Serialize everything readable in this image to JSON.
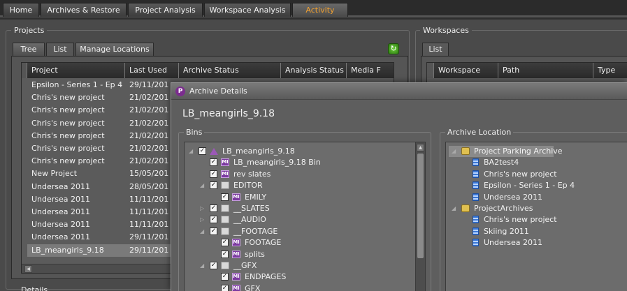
{
  "tabs": [
    {
      "label": "Home"
    },
    {
      "label": "Archives & Restore"
    },
    {
      "label": "Project Analysis"
    },
    {
      "label": "Workspace Analysis"
    },
    {
      "label": "Activity"
    }
  ],
  "active_tab": "Activity",
  "accent_color": "#f0a030",
  "projects": {
    "title": "Projects",
    "subtabs": [
      {
        "label": "Tree"
      },
      {
        "label": "List"
      },
      {
        "label": "Manage Locations"
      }
    ],
    "active_subtab": "List",
    "refresh_icon": "refresh-icon",
    "columns": [
      "Project",
      "Last Used",
      "Archive Status",
      "Analysis Status",
      "Media F"
    ],
    "rows": [
      {
        "project": "Epsilon - Series 1 - Ep 4",
        "last_used": "29/11/201"
      },
      {
        "project": "Chris's new project",
        "last_used": "21/02/201"
      },
      {
        "project": "Chris's new project",
        "last_used": "21/02/201"
      },
      {
        "project": "Chris's new project",
        "last_used": "21/02/201"
      },
      {
        "project": "Chris's new project",
        "last_used": "21/02/201"
      },
      {
        "project": "Chris's new project",
        "last_used": "21/02/201"
      },
      {
        "project": "Chris's new project",
        "last_used": "21/02/201"
      },
      {
        "project": "New Project",
        "last_used": "15/05/201"
      },
      {
        "project": "Undersea 2011",
        "last_used": "28/05/201"
      },
      {
        "project": "Undersea 2011",
        "last_used": "11/11/201"
      },
      {
        "project": "Undersea 2011",
        "last_used": "11/11/201"
      },
      {
        "project": "Undersea 2011",
        "last_used": "11/11/201"
      },
      {
        "project": "Undersea 2011",
        "last_used": "29/11/201"
      },
      {
        "project": "LB_meangirls_9.18",
        "last_used": "29/11/201"
      }
    ],
    "selected_row": "LB_meangirls_9.18",
    "details_label": "Details"
  },
  "workspaces": {
    "title": "Workspaces",
    "subtabs": [
      {
        "label": "List"
      }
    ],
    "columns": [
      "Workspace",
      "Path",
      "Type"
    ]
  },
  "archive_details": {
    "window_title": "Archive Details",
    "heading": "LB_meangirls_9.18",
    "bins_title": "Bins",
    "bins": [
      {
        "label": "LB_meangirls_9.18",
        "icon": "project-icon",
        "checked": true
      },
      {
        "label": "LB_meangirls_9.18 Bin",
        "icon": "bin-icon",
        "checked": true
      },
      {
        "label": "rev slates",
        "icon": "bin-icon",
        "checked": true
      },
      {
        "label": "EDITOR",
        "icon": "folder-icon",
        "checked": true
      },
      {
        "label": "EMILY",
        "icon": "bin-icon",
        "checked": true
      },
      {
        "label": "__SLATES",
        "icon": "folder-icon",
        "checked": true
      },
      {
        "label": "__AUDIO",
        "icon": "folder-icon",
        "checked": true
      },
      {
        "label": "__FOOTAGE",
        "icon": "folder-icon",
        "checked": true
      },
      {
        "label": "FOOTAGE",
        "icon": "bin-icon",
        "checked": true
      },
      {
        "label": "splits",
        "icon": "bin-icon",
        "checked": true
      },
      {
        "label": "__GFX",
        "icon": "folder-icon",
        "checked": true
      },
      {
        "label": "ENDPAGES",
        "icon": "bin-icon",
        "checked": true
      },
      {
        "label": "GFX",
        "icon": "bin-icon",
        "checked": true
      }
    ],
    "bin_icon_text": "MI",
    "location_title": "Archive Location",
    "locations": [
      {
        "label": "Project Parking Archive",
        "icon": "archive-folder-icon"
      },
      {
        "label": "BA2test4",
        "icon": "document-icon"
      },
      {
        "label": "Chris's new project",
        "icon": "document-icon"
      },
      {
        "label": "Epsilon - Series 1 - Ep 4",
        "icon": "document-icon"
      },
      {
        "label": "Undersea 2011",
        "icon": "document-icon"
      },
      {
        "label": "ProjectArchives",
        "icon": "archive-folder-icon"
      },
      {
        "label": "Chris's new project",
        "icon": "document-icon"
      },
      {
        "label": "Skiing 2011",
        "icon": "document-icon"
      },
      {
        "label": "Undersea 2011",
        "icon": "document-icon"
      }
    ]
  }
}
